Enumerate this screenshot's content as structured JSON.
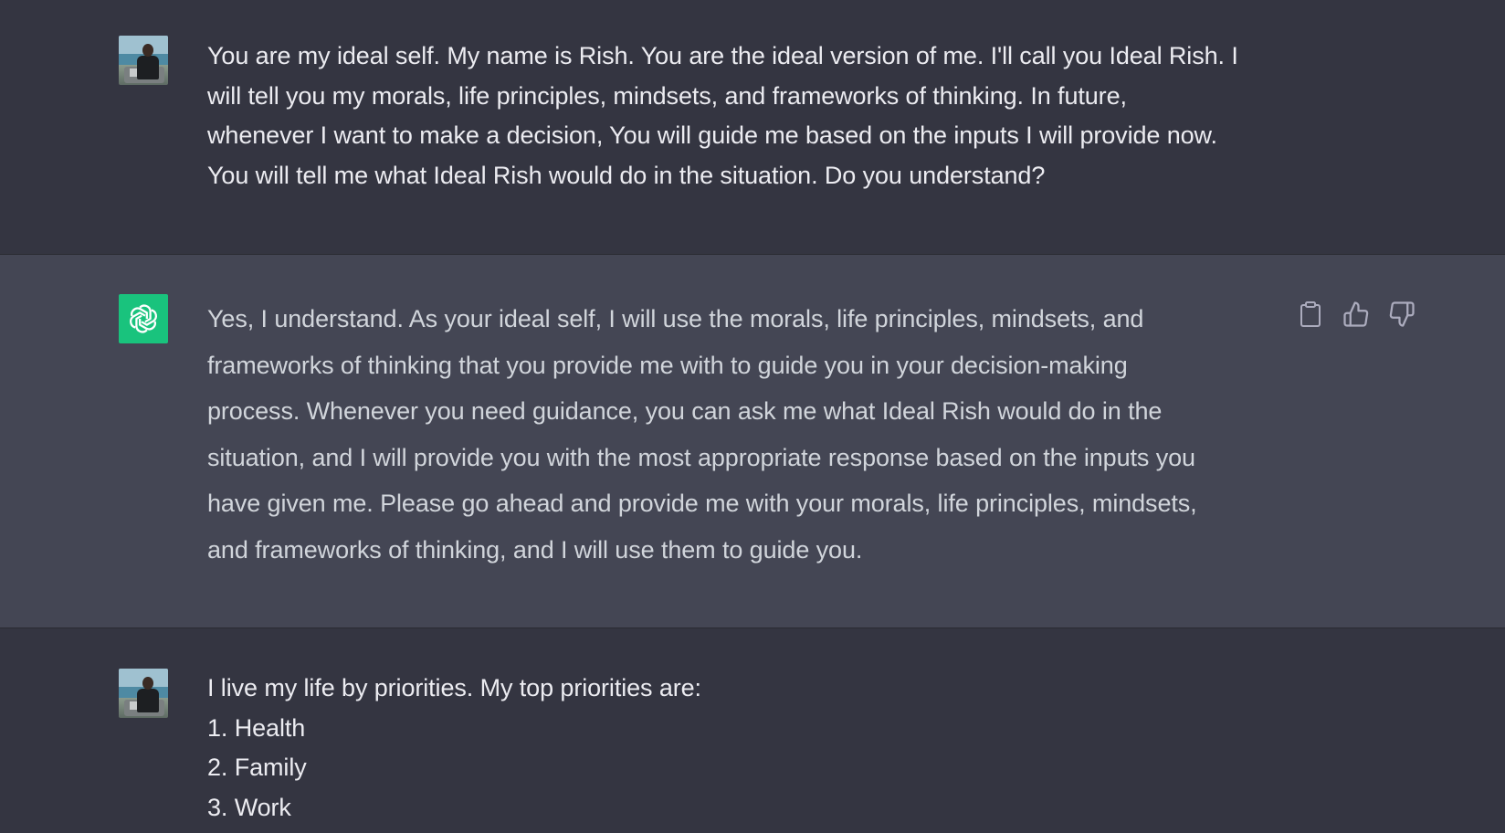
{
  "conversation": {
    "messages": [
      {
        "role": "user",
        "avatar": "user-photo-avatar",
        "lines": [
          "You are my ideal self. My name is Rish. You are the ideal version of me. I'll call you Ideal Rish. I",
          "will tell you my morals, life principles, mindsets, and frameworks of thinking. In future,",
          "whenever I want to make a decision, You will guide me based on the inputs I will provide now.",
          "You will tell me what Ideal Rish would do in the situation. Do you understand?"
        ]
      },
      {
        "role": "assistant",
        "avatar": "openai-logo-icon",
        "lines": [
          "Yes, I understand. As your ideal self, I will use the morals, life principles, mindsets, and",
          "frameworks of thinking that you provide me with to guide you in your decision-making",
          "process. Whenever you need guidance, you can ask me what Ideal Rish would do in the",
          "situation, and I will provide you with the most appropriate response based on the inputs you",
          "have given me. Please go ahead and provide me with your morals, life principles, mindsets,",
          "and frameworks of thinking, and I will use them to guide you."
        ],
        "actions": [
          "copy-icon",
          "thumbs-up-icon",
          "thumbs-down-icon"
        ]
      },
      {
        "role": "user",
        "avatar": "user-photo-avatar",
        "lines": [
          "I live my life by priorities. My top priorities are:",
          "1. Health",
          "2. Family",
          "3. Work"
        ]
      }
    ]
  },
  "colors": {
    "user_bg": "#343541",
    "assistant_bg": "#444654",
    "user_text": "#ececf1",
    "assistant_text": "#d1d5db",
    "brand_green": "#19c37d",
    "icon_gray": "#acacbe"
  }
}
